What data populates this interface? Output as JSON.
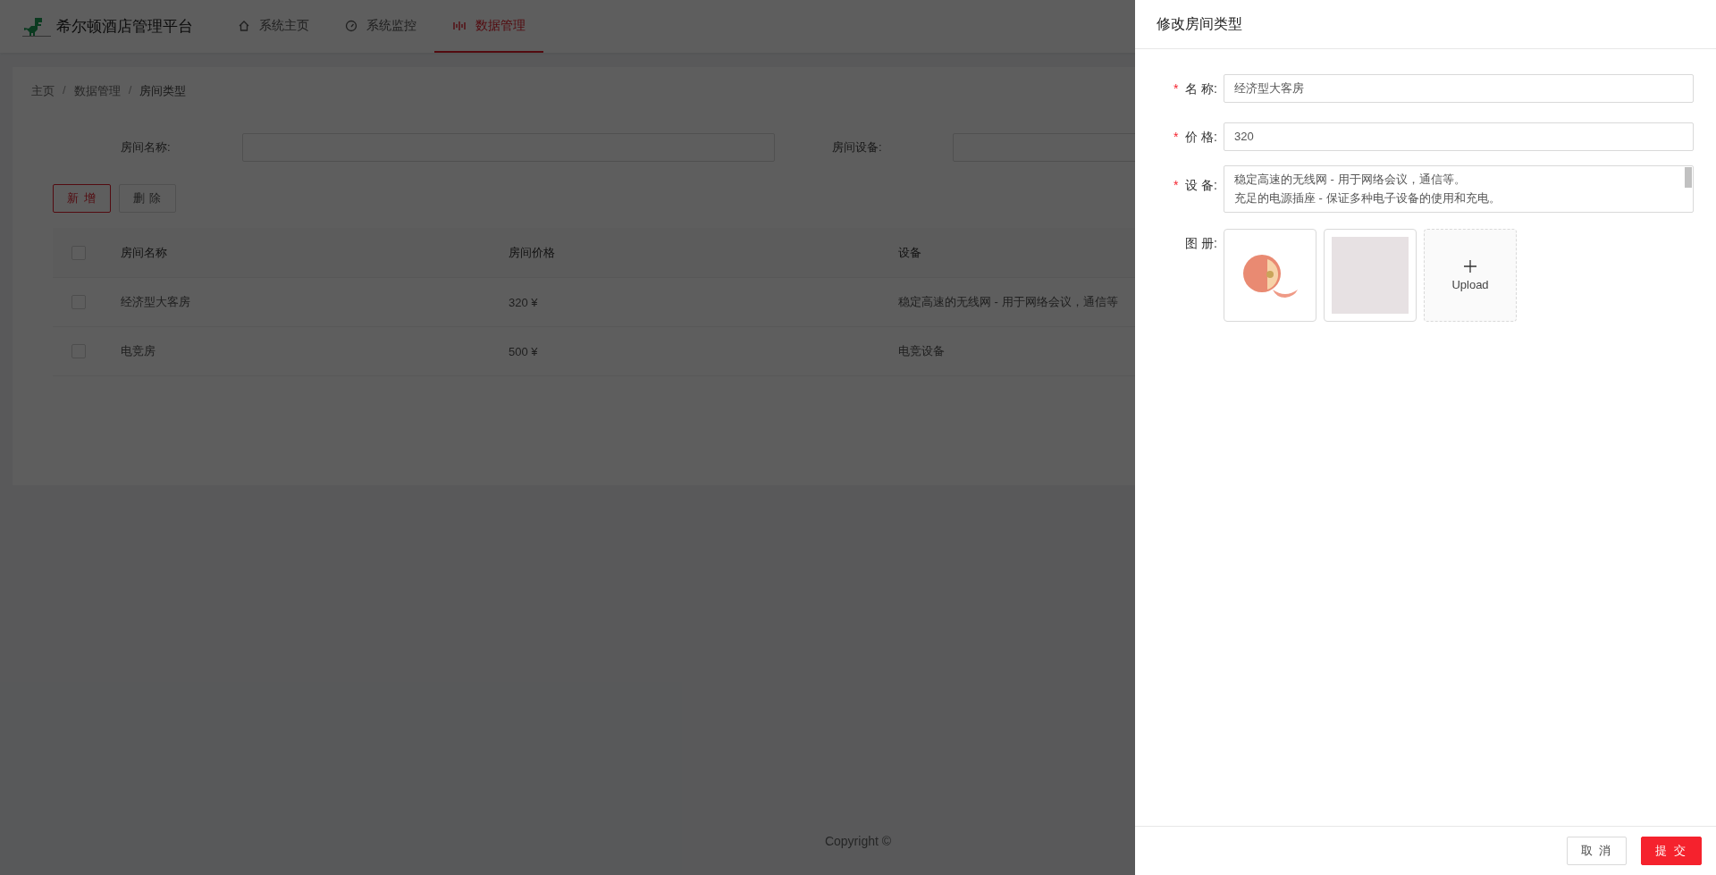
{
  "header": {
    "title": "希尔顿酒店管理平台",
    "nav": [
      {
        "label": "系统主页",
        "kind": "home",
        "selected": false
      },
      {
        "label": "系统监控",
        "kind": "gauge",
        "selected": false
      },
      {
        "label": "数据管理",
        "kind": "signal",
        "selected": true
      }
    ]
  },
  "breadcrumb": [
    {
      "kind": "link",
      "text": "主页"
    },
    {
      "kind": "separator",
      "text": "/"
    },
    {
      "kind": "link",
      "text": "数据管理"
    },
    {
      "kind": "separator",
      "text": "/"
    },
    {
      "kind": "link",
      "text": "房间类型"
    }
  ],
  "search": [
    {
      "label": "房间名称:"
    },
    {
      "label": "房间设备:"
    }
  ],
  "toolbar": [
    {
      "label": "新 增",
      "kind": "primary"
    },
    {
      "label": "删 除",
      "kind": "default"
    }
  ],
  "table": {
    "select_all": {
      "checked": false
    },
    "columns": [
      "房间名称",
      "房间价格",
      "设备"
    ],
    "rows": [
      {
        "checked": false,
        "cells": [
          "经济型大客房",
          "320 ¥",
          "稳定高速的无线网 - 用于网络会议，通信等"
        ]
      },
      {
        "checked": false,
        "cells": [
          "电竞房",
          "500 ¥",
          "电竞设备"
        ]
      }
    ]
  },
  "footer": "Copyright ©",
  "drawer": {
    "title": "修改房间类型",
    "fields": [
      {
        "label": "名 称:",
        "required_mark": "*",
        "kind": "input",
        "value": "经济型大客房"
      },
      {
        "label": "价 格:",
        "required_mark": "*",
        "kind": "input",
        "value": "320"
      },
      {
        "label": "设 备:",
        "required_mark": "*",
        "kind": "textarea",
        "lines": [
          "稳定高速的无线网 - 用于网络会议，通信等。",
          "充足的电源插座 - 保证多种电子设备的使用和充电。"
        ]
      }
    ],
    "album": {
      "label": "图 册:",
      "upload_label": "Upload"
    },
    "buttons": [
      {
        "label": "取 消",
        "kind": "default"
      },
      {
        "label": "提 交",
        "kind": "primary"
      }
    ]
  }
}
